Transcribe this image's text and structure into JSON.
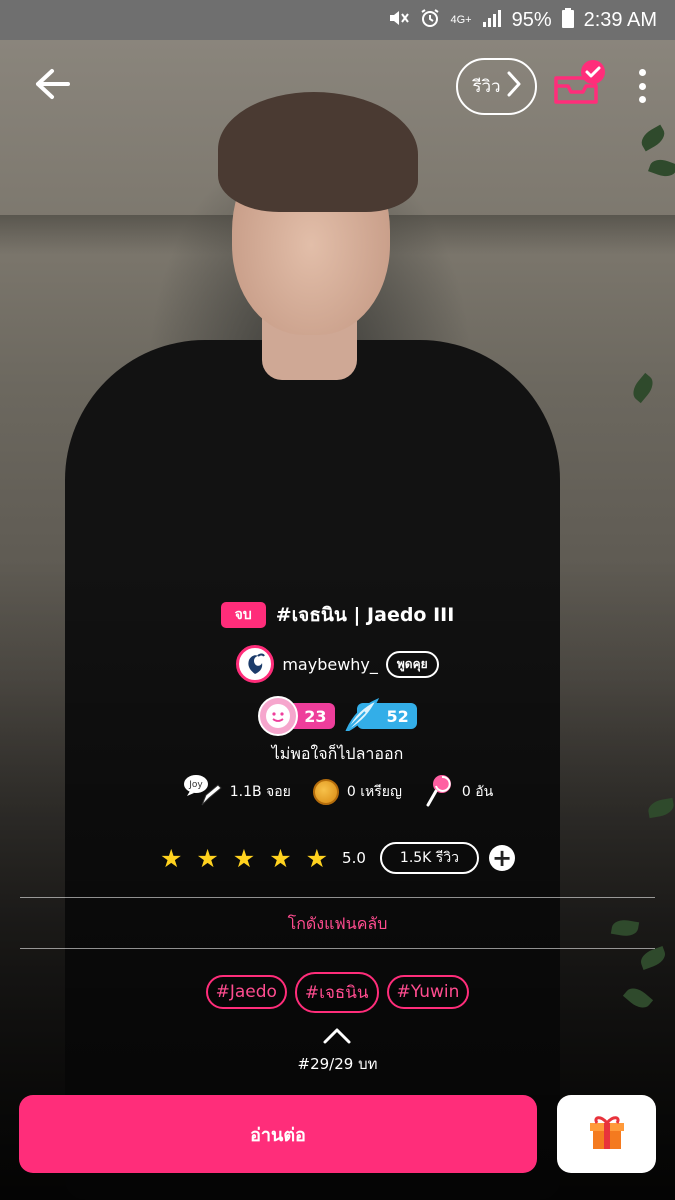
{
  "status_bar": {
    "network": "4G+",
    "battery": "95%",
    "time": "2:39 AM"
  },
  "header": {
    "review_label": "รีวิว"
  },
  "story": {
    "status": "จบ",
    "title": "#เจธนิน | Jaedo III",
    "author": "maybewhy_",
    "chat_label": "พูดคุย",
    "level_count": "23",
    "writer_count": "52",
    "tagline": "ไม่พอใจก็ไปลาออก",
    "stats": {
      "joy_label": "Joy",
      "joy": "1.1B จอย",
      "coins": "0 เหรียญ",
      "lollipops": "0 อัน"
    },
    "rating": {
      "stars": 5,
      "value": "5.0",
      "reviews_label": "1.5K รีวิว",
      "add_symbol": "+"
    },
    "fanclub_label": "โกดังแฟนคลับ",
    "tags": [
      "#Jaedo",
      "#เจธนิน",
      "#Yuwin"
    ],
    "episode": "#29/29 บท"
  },
  "actions": {
    "read_label": "อ่านต่อ"
  },
  "colors": {
    "accent": "#ff2d7a",
    "star": "#ffd21f",
    "writer_badge": "#33aee8"
  },
  "icons": {
    "back": "arrow-left-icon",
    "review_chevron": "chevron-right-icon",
    "inbox": "inbox-check-icon",
    "menu": "more-vertical-icon",
    "gift": "gift-icon"
  }
}
